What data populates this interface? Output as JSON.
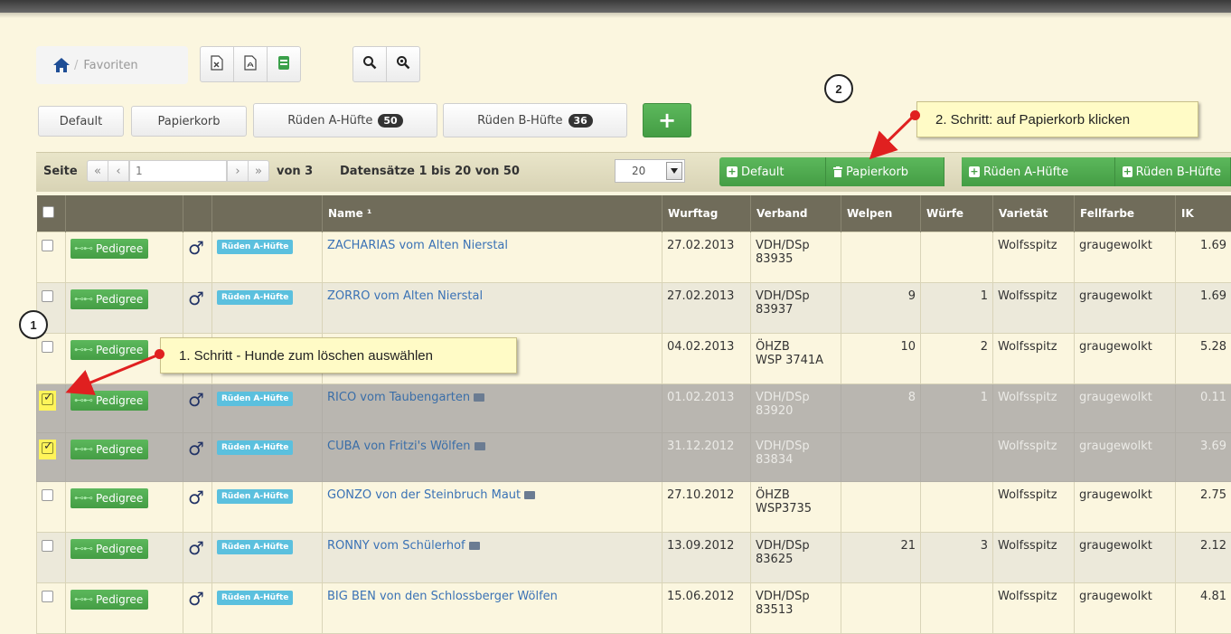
{
  "breadcrumb": {
    "home_icon": "home-icon",
    "separator": "/",
    "label": "Favoriten"
  },
  "toolbar": {
    "export_icons": [
      "excel-export-icon",
      "pdf-export-icon",
      "csv-export-icon"
    ],
    "search_icons": [
      "search-icon",
      "search-reset-icon"
    ]
  },
  "views": [
    {
      "label": "Default"
    },
    {
      "label": "Papierkorb"
    },
    {
      "label": "Rüden A-Hüfte",
      "count": "50"
    },
    {
      "label": "Rüden B-Hüfte",
      "count": "36"
    }
  ],
  "add_view_label": "+",
  "pager": {
    "seite_label": "Seite",
    "first": "«",
    "prev": "‹",
    "page_value": "1",
    "next": "›",
    "last": "»",
    "von_label": "von 3",
    "records_label": "Datensätze 1 bis 20 von 50",
    "per_page": "20"
  },
  "move_buttons": [
    {
      "label": "Default",
      "icon": "plus-square-icon"
    },
    {
      "label": "Papierkorb",
      "icon": "trash-icon"
    },
    {
      "label": "Rüden A-Hüfte",
      "icon": "plus-square-icon"
    },
    {
      "label": "Rüden B-Hüfte",
      "icon": "plus-square-icon"
    }
  ],
  "table": {
    "columns": [
      "",
      "",
      "",
      "",
      "Name ¹",
      "Wurftag",
      "Verband",
      "Welpen",
      "Würfe",
      "Varietät",
      "Fellfarbe",
      "IK"
    ],
    "pedigree_label": "Pedigree",
    "gender_symbol": "♂",
    "tag_label": "Rüden A-Hüfte",
    "rows": [
      {
        "checked": false,
        "name": "ZACHARIAS vom Alten Nierstal",
        "photo": false,
        "wurftag": "27.02.2013",
        "verband1": "VDH/DSp",
        "verband2": "83935",
        "welpen": "",
        "wuerfe": "",
        "varietaet": "Wolfsspitz",
        "fellfarbe": "graugewolkt",
        "ik": "1.69"
      },
      {
        "checked": false,
        "name": "ZORRO vom Alten Nierstal",
        "photo": false,
        "wurftag": "27.02.2013",
        "verband1": "VDH/DSp",
        "verband2": "83937",
        "welpen": "9",
        "wuerfe": "1",
        "varietaet": "Wolfsspitz",
        "fellfarbe": "graugewolkt",
        "ik": "1.69"
      },
      {
        "checked": false,
        "name": "",
        "photo": true,
        "wurftag": "04.02.2013",
        "verband1": "ÖHZB",
        "verband2": "WSP 3741A",
        "welpen": "10",
        "wuerfe": "2",
        "varietaet": "Wolfsspitz",
        "fellfarbe": "graugewolkt",
        "ik": "5.28"
      },
      {
        "checked": true,
        "name": "RICO vom Taubengarten",
        "photo": true,
        "wurftag": "01.02.2013",
        "verband1": "VDH/DSp",
        "verband2": "83920",
        "welpen": "8",
        "wuerfe": "1",
        "varietaet": "Wolfsspitz",
        "fellfarbe": "graugewolkt",
        "ik": "0.11"
      },
      {
        "checked": true,
        "name": "CUBA von Fritzi's Wölfen",
        "photo": true,
        "wurftag": "31.12.2012",
        "verband1": "VDH/DSp",
        "verband2": "83834",
        "welpen": "",
        "wuerfe": "",
        "varietaet": "Wolfsspitz",
        "fellfarbe": "graugewolkt",
        "ik": "3.69"
      },
      {
        "checked": false,
        "name": "GONZO von der Steinbruch Maut",
        "photo": true,
        "wurftag": "27.10.2012",
        "verband1": "ÖHZB",
        "verband2": "WSP3735",
        "welpen": "",
        "wuerfe": "",
        "varietaet": "Wolfsspitz",
        "fellfarbe": "graugewolkt",
        "ik": "2.75"
      },
      {
        "checked": false,
        "name": "RONNY vom Schülerhof",
        "photo": true,
        "wurftag": "13.09.2012",
        "verband1": "VDH/DSp",
        "verband2": "83625",
        "welpen": "21",
        "wuerfe": "3",
        "varietaet": "Wolfsspitz",
        "fellfarbe": "graugewolkt",
        "ik": "2.12"
      },
      {
        "checked": false,
        "name": "BIG BEN von den Schlossberger Wölfen",
        "photo": false,
        "wurftag": "15.06.2012",
        "verband1": "VDH/DSp",
        "verband2": "83513",
        "welpen": "",
        "wuerfe": "",
        "varietaet": "Wolfsspitz",
        "fellfarbe": "graugewolkt",
        "ik": "4.81"
      }
    ]
  },
  "annotations": {
    "step1_number": "1",
    "step1_text": "1. Schritt - Hunde zum löschen auswählen",
    "step2_number": "2",
    "step2_text": "2. Schritt: auf Papierkorb klicken",
    "arrow_color": "#e02020",
    "highlight_color": "#fff45a"
  }
}
